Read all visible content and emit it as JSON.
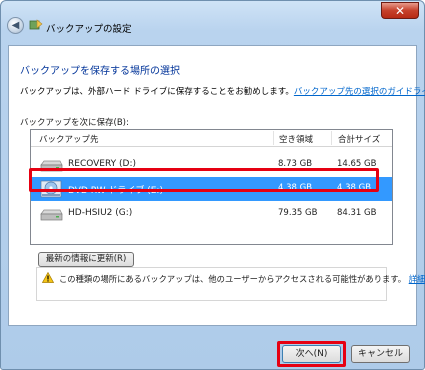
{
  "window": {
    "title": "バックアップの設定",
    "close_glyph": "✕",
    "back_glyph": "◀"
  },
  "main": {
    "heading": "バックアップを保存する場所の選択",
    "description": "バックアップは、外部ハード ドライブに保存することをお勧めします。",
    "guide_link": "バックアップ先の選択のガイドライン",
    "save_to_label": "バックアップを次に保存(B):"
  },
  "list": {
    "columns": [
      "バックアップ先",
      "空き領域",
      "合計サイズ"
    ],
    "rows": [
      {
        "name": "RECOVERY (D:)",
        "free": "8.73 GB",
        "total": "14.65 GB",
        "icon": "hard-drive-icon"
      },
      {
        "name": "DVD RW ドライブ (E:)",
        "free": "4.38 GB",
        "total": "4.38 GB",
        "icon": "dvd-drive-icon",
        "selected": true
      },
      {
        "name": "HD-HSIU2 (G:)",
        "free": "79.35 GB",
        "total": "84.31 GB",
        "icon": "hard-drive-icon"
      }
    ]
  },
  "refresh_button": "最新の情報に更新(R)",
  "warning": {
    "text": "この種類の場所にあるバックアップは、他のユーザーからアクセスされる可能性があります。",
    "link": "詳細情報",
    "icon": "warning-icon"
  },
  "footer": {
    "next_label": "次へ(N)",
    "cancel_label": "キャンセル"
  },
  "colors": {
    "selection": "#3399ff",
    "highlight": "#e60012",
    "heading": "#003399",
    "link": "#0066cc"
  }
}
